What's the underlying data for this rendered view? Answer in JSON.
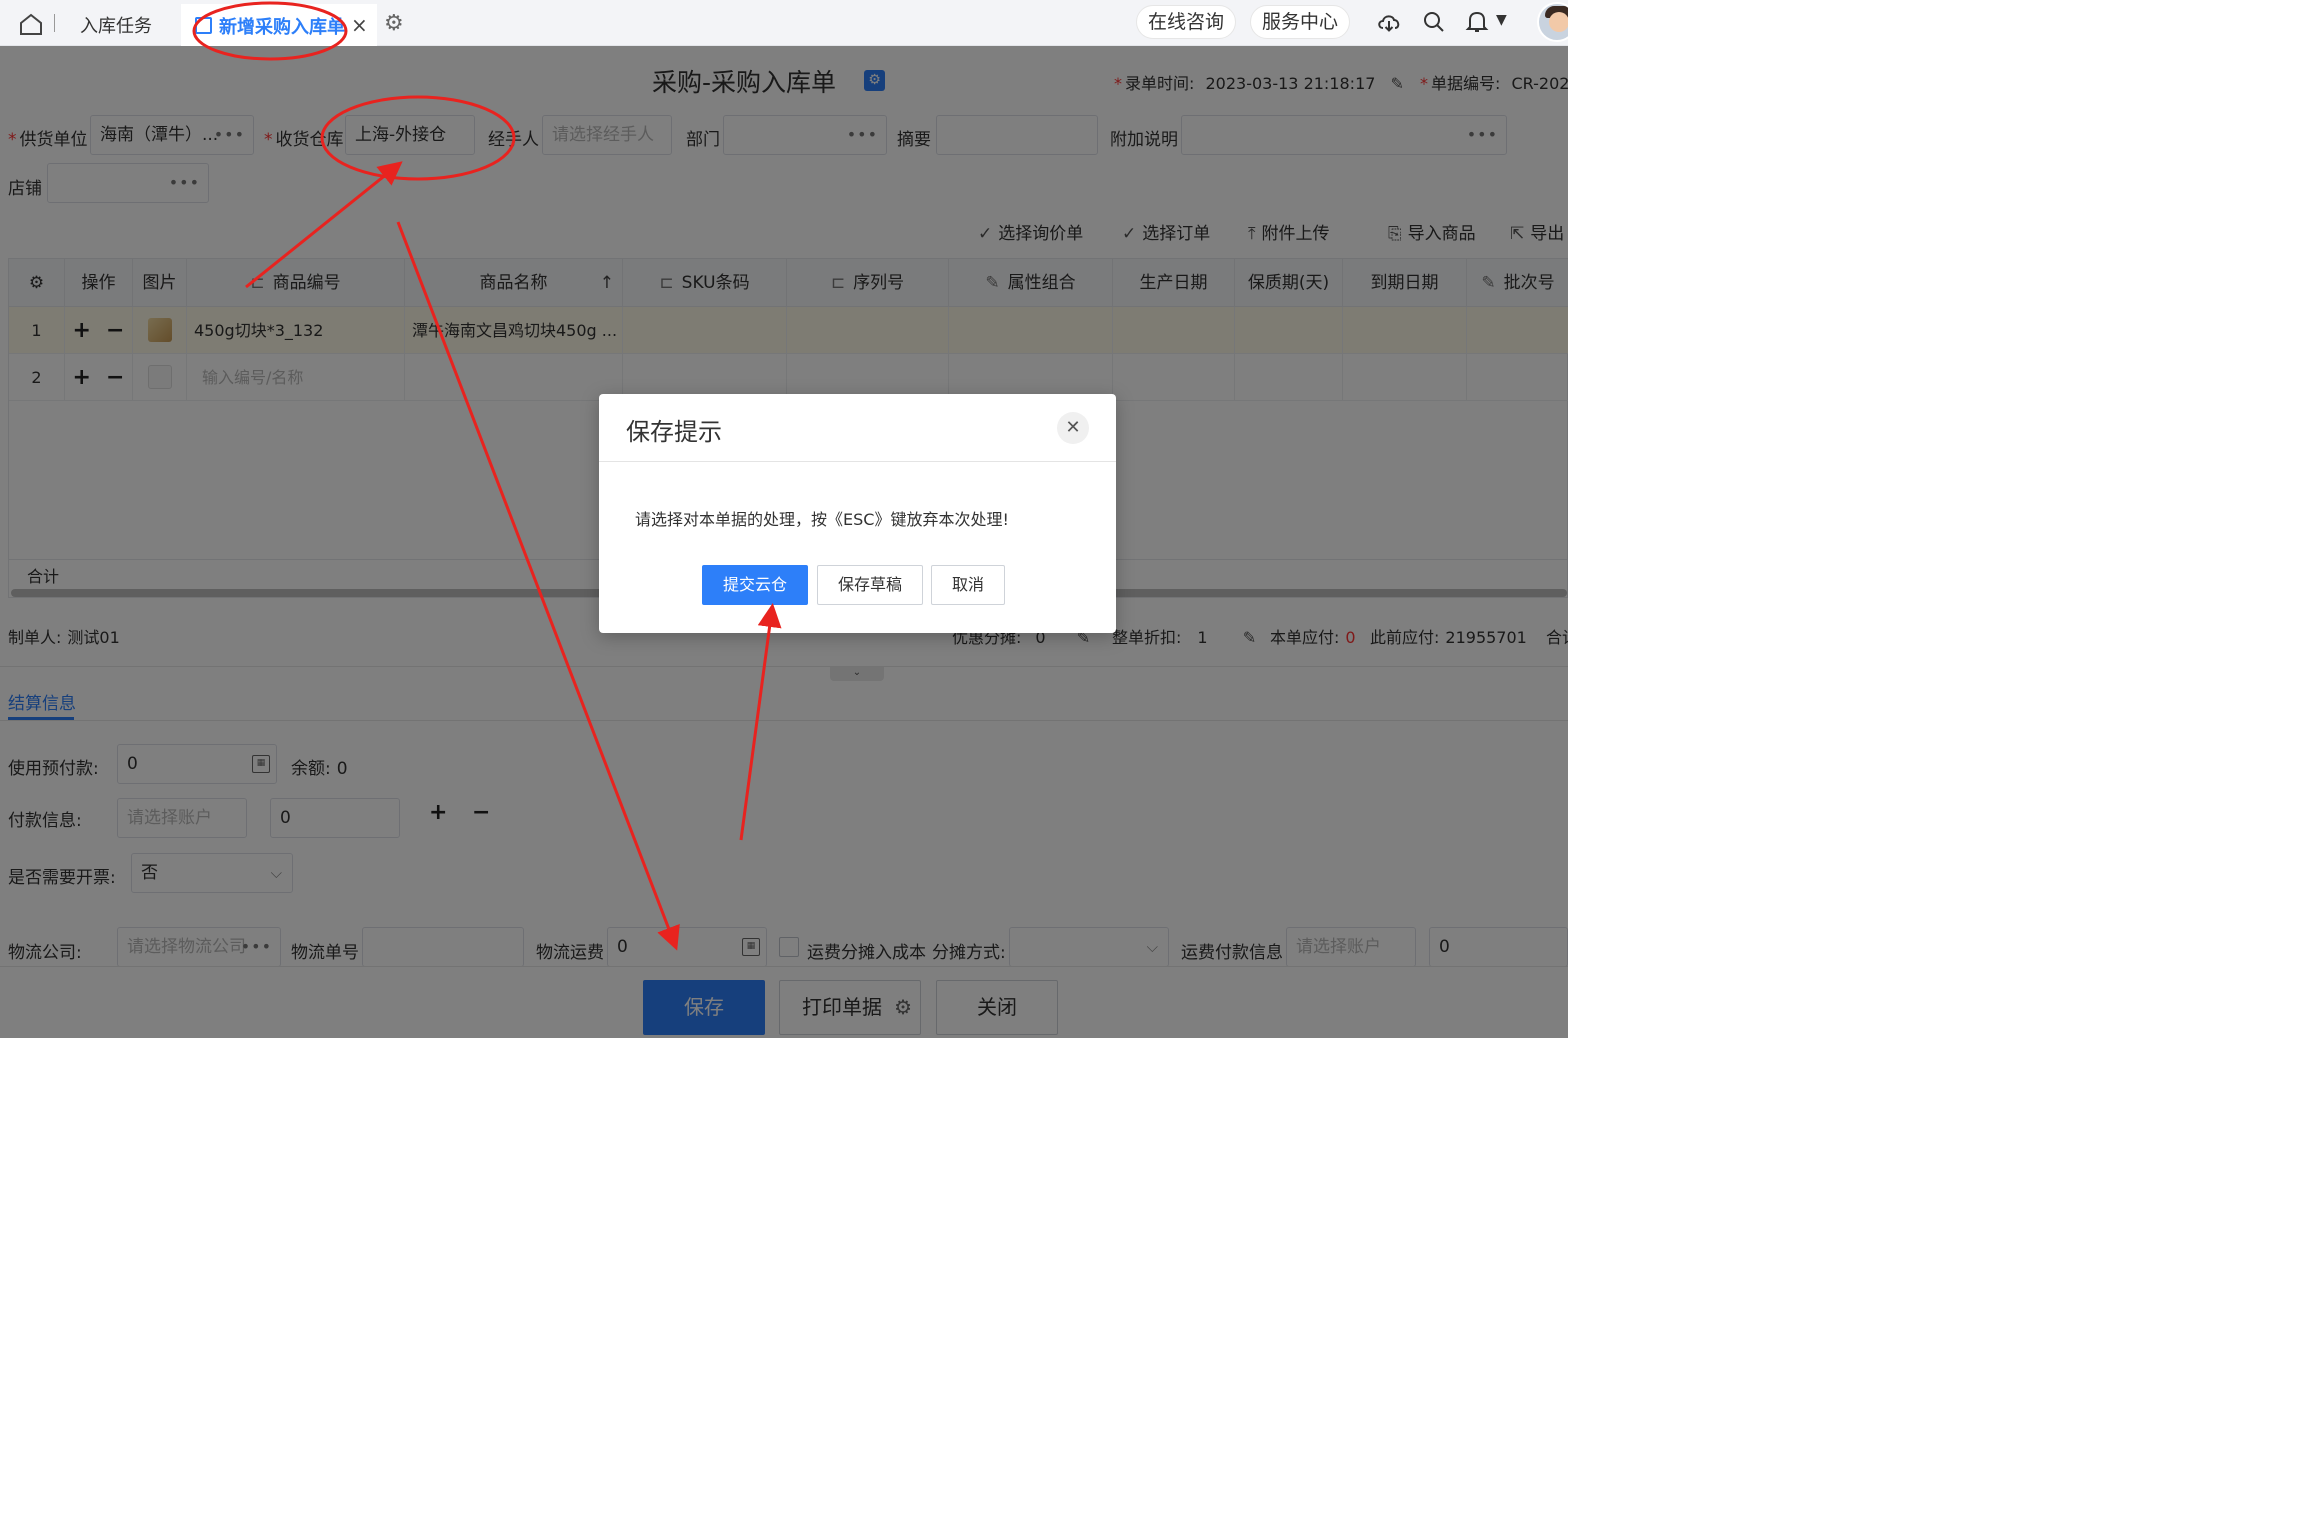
{
  "tabs": {
    "task_label": "入库任务",
    "active_label": "新增采购入库单",
    "close_glyph": "×"
  },
  "topbar": {
    "consult_label": "在线咨询",
    "service_label": "服务中心"
  },
  "form": {
    "title": "采购-采购入库单",
    "entry_time_label": "录单时间:",
    "entry_time_value": "2023-03-13 21:18:17",
    "doc_no_label": "单据编号:",
    "doc_no_value": "CR-202",
    "supplier_label": "供货单位",
    "supplier_value": "海南（潭牛）...",
    "warehouse_label": "收货仓库",
    "warehouse_value": "上海-外接仓",
    "handler_label": "经手人",
    "handler_placeholder": "请选择经手人",
    "dept_label": "部门",
    "summary_label": "摘要",
    "remark_label": "附加说明",
    "shop_label": "店铺"
  },
  "toolbar": {
    "select_inquiry": "选择询价单",
    "select_order": "选择订单",
    "upload_attachment": "附件上传",
    "import_goods": "导入商品",
    "export": "导出"
  },
  "table": {
    "columns": [
      "操作",
      "图片",
      "商品编号",
      "商品名称",
      "SKU条码",
      "序列号",
      "属性组合",
      "生产日期",
      "保质期(天)",
      "到期日期",
      "批次号"
    ],
    "rows": [
      {
        "no": "1",
        "code": "450g切块*3_132",
        "name": "潭牛海南文昌鸡切块450g ..."
      },
      {
        "no": "2",
        "code_placeholder": "输入编号/名称"
      }
    ],
    "sum_label": "合计"
  },
  "footer": {
    "maker_label": "制单人:",
    "maker_value": "测试01",
    "discount_label": "优惠分摊:",
    "discount_value": "0",
    "whole_discount_label": "整单折扣:",
    "whole_discount_value": "1",
    "payable_label": "本单应付:",
    "payable_value": "0",
    "prev_payable_label": "此前应付:",
    "prev_payable_value": "21955701",
    "total_label": "合计"
  },
  "settle": {
    "tab_label": "结算信息",
    "prepay_label": "使用预付款:",
    "prepay_value": "0",
    "balance_label": "余额:",
    "balance_value": "0",
    "payment_label": "付款信息:",
    "account_placeholder": "请选择账户",
    "payment_value": "0",
    "invoice_label": "是否需要开票:",
    "invoice_value": "否",
    "logistics_company_label": "物流公司:",
    "logistics_company_placeholder": "请选择物流公司",
    "logistics_no_label": "物流单号",
    "freight_label": "物流运费",
    "freight_value": "0",
    "freight_cost_label": "运费分摊入成本",
    "allocate_label": "分摊方式:",
    "freight_pay_label": "运费付款信息",
    "freight_account_placeholder": "请选择账户",
    "freight_pay_value": "0"
  },
  "bottom": {
    "save_label": "保存",
    "print_label": "打印单据",
    "close_label": "关闭"
  },
  "modal": {
    "title": "保存提示",
    "message": "请选择对本单据的处理，按《ESC》键放弃本次处理!",
    "submit_label": "提交云仓",
    "draft_label": "保存草稿",
    "cancel_label": "取消"
  },
  "colors": {
    "accent": "#2d7ff9",
    "annotation_red": "#e8231f",
    "highlight_row": "#fdf8e6"
  }
}
